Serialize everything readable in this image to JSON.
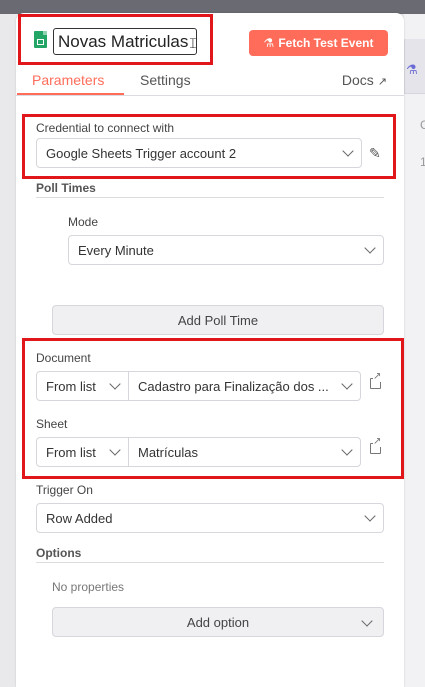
{
  "header": {
    "title_value": "Novas Matriculas",
    "fetch_label": "Fetch Test Event",
    "fetch_icon": "flask-icon"
  },
  "tabs": {
    "parameters": "Parameters",
    "settings": "Settings",
    "docs": "Docs"
  },
  "credential": {
    "label": "Credential to connect with",
    "value": "Google Sheets Trigger account 2"
  },
  "poll": {
    "label": "Poll Times",
    "mode_label": "Mode",
    "mode_value": "Every Minute",
    "add_label": "Add Poll Time"
  },
  "document": {
    "label": "Document",
    "source": "From list",
    "value": "Cadastro para Finalização dos ..."
  },
  "sheet": {
    "label": "Sheet",
    "source": "From list",
    "value": "Matrículas"
  },
  "trigger": {
    "label": "Trigger On",
    "value": "Row Added"
  },
  "options": {
    "label": "Options",
    "empty_text": "No properties",
    "add_label": "Add option"
  },
  "side": {
    "c1": "C",
    "c2": "1"
  },
  "colors": {
    "accent": "#ff6d5a",
    "highlight": "#e0161b",
    "sheets_green": "#23a566"
  }
}
